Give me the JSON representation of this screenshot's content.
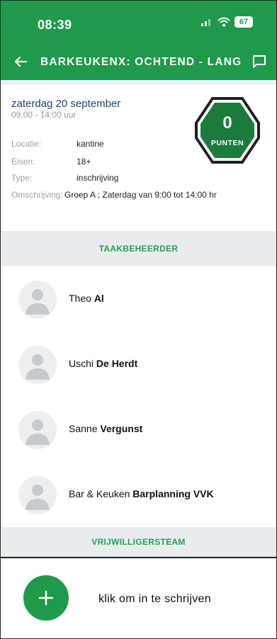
{
  "status_bar": {
    "time": "08:39",
    "battery": "67"
  },
  "header": {
    "title": "BARKEUKENX: OCHTEND - LANG"
  },
  "shift": {
    "date": "zaterdag 20 september",
    "hours": "09:00 - 14:00 uur",
    "points": {
      "value": "0",
      "label": "PUNTEN"
    },
    "details": [
      {
        "label": "Locatie:",
        "value": "kantine"
      },
      {
        "label": "Eisen:",
        "value": "18+"
      },
      {
        "label": "Type:",
        "value": "inschrijving"
      },
      {
        "label": "Omschrijving:",
        "value": "Groep A ; Zaterdag van 9:00 tot 14:00 hr"
      }
    ]
  },
  "sections": {
    "managers": "TAAKBEHEERDER",
    "volunteers": "VRIJWILLIGERSTEAM"
  },
  "managers": [
    {
      "first": "Theo",
      "last": "Al"
    },
    {
      "first": "Uschi",
      "last": "De Herdt"
    },
    {
      "first": "Sanne",
      "last": "Vergunst"
    },
    {
      "first": "Bar & Keuken",
      "last": "Barplanning VVK"
    }
  ],
  "signup": {
    "label": "klik om in te schrijven"
  },
  "colors": {
    "primary": "#1e9a4a",
    "section_bg": "#e9ecee",
    "date_text": "#1d3f7a"
  },
  "icons": {
    "back": "arrow-left-icon",
    "chat": "chat-bubble-icon",
    "add": "plus-icon"
  }
}
